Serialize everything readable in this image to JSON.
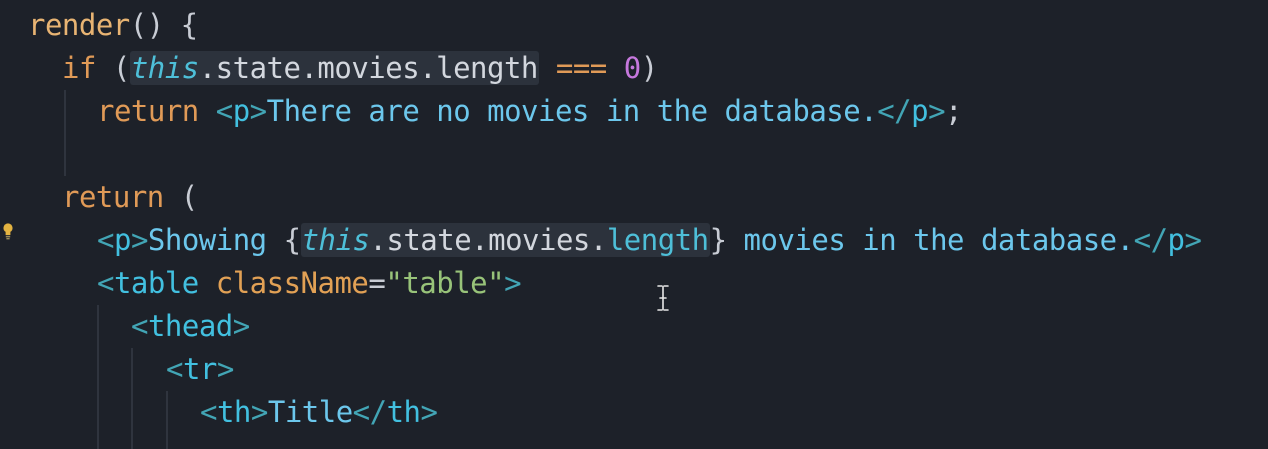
{
  "editor": {
    "colors": {
      "background": "#1d2129",
      "keyword": "#e09a57",
      "tag": "#42c0e0",
      "text": "#6cc7ec",
      "string": "#98c379",
      "number": "#c678dd"
    },
    "lines": {
      "l1": {
        "t1": "render",
        "t2": "() {"
      },
      "l2": {
        "t1": "if",
        "t2": " (",
        "t3": "this",
        "t4": ".state.movies.length",
        "t5": " ",
        "t6": "===",
        "t7": " ",
        "t8": "0",
        "t9": ")"
      },
      "l3": {
        "t1": "return",
        "t2": " ",
        "t3": "<",
        "t4": "p",
        "t5": ">",
        "t6": "There are no movies in the database.",
        "t7": "</",
        "t8": "p",
        "t9": ">",
        "t10": ";"
      },
      "l5": {
        "t1": "return",
        "t2": " ("
      },
      "l6": {
        "t1": "<",
        "t2": "p",
        "t3": ">",
        "t4": "Showing ",
        "t5": "{",
        "t6": "this",
        "t7": ".state.movies.",
        "t8": "length",
        "t9": "}",
        "t10": " movies in the database.",
        "t11": "</",
        "t12": "p",
        "t13": ">"
      },
      "l7": {
        "t1": "<",
        "t2": "table",
        "t3": " ",
        "t4": "className",
        "t5": "=",
        "t6": "\"table\"",
        "t7": ">"
      },
      "l8": {
        "t1": "<",
        "t2": "thead",
        "t3": ">"
      },
      "l9": {
        "t1": "<",
        "t2": "tr",
        "t3": ">"
      },
      "l10": {
        "t1": "<",
        "t2": "th",
        "t3": ">",
        "t4": "Title",
        "t5": "</",
        "t6": "th",
        "t7": ">"
      }
    },
    "gutter": {
      "icon": "lightbulb-icon"
    },
    "pointer": {
      "icon": "text-cursor-icon"
    }
  }
}
